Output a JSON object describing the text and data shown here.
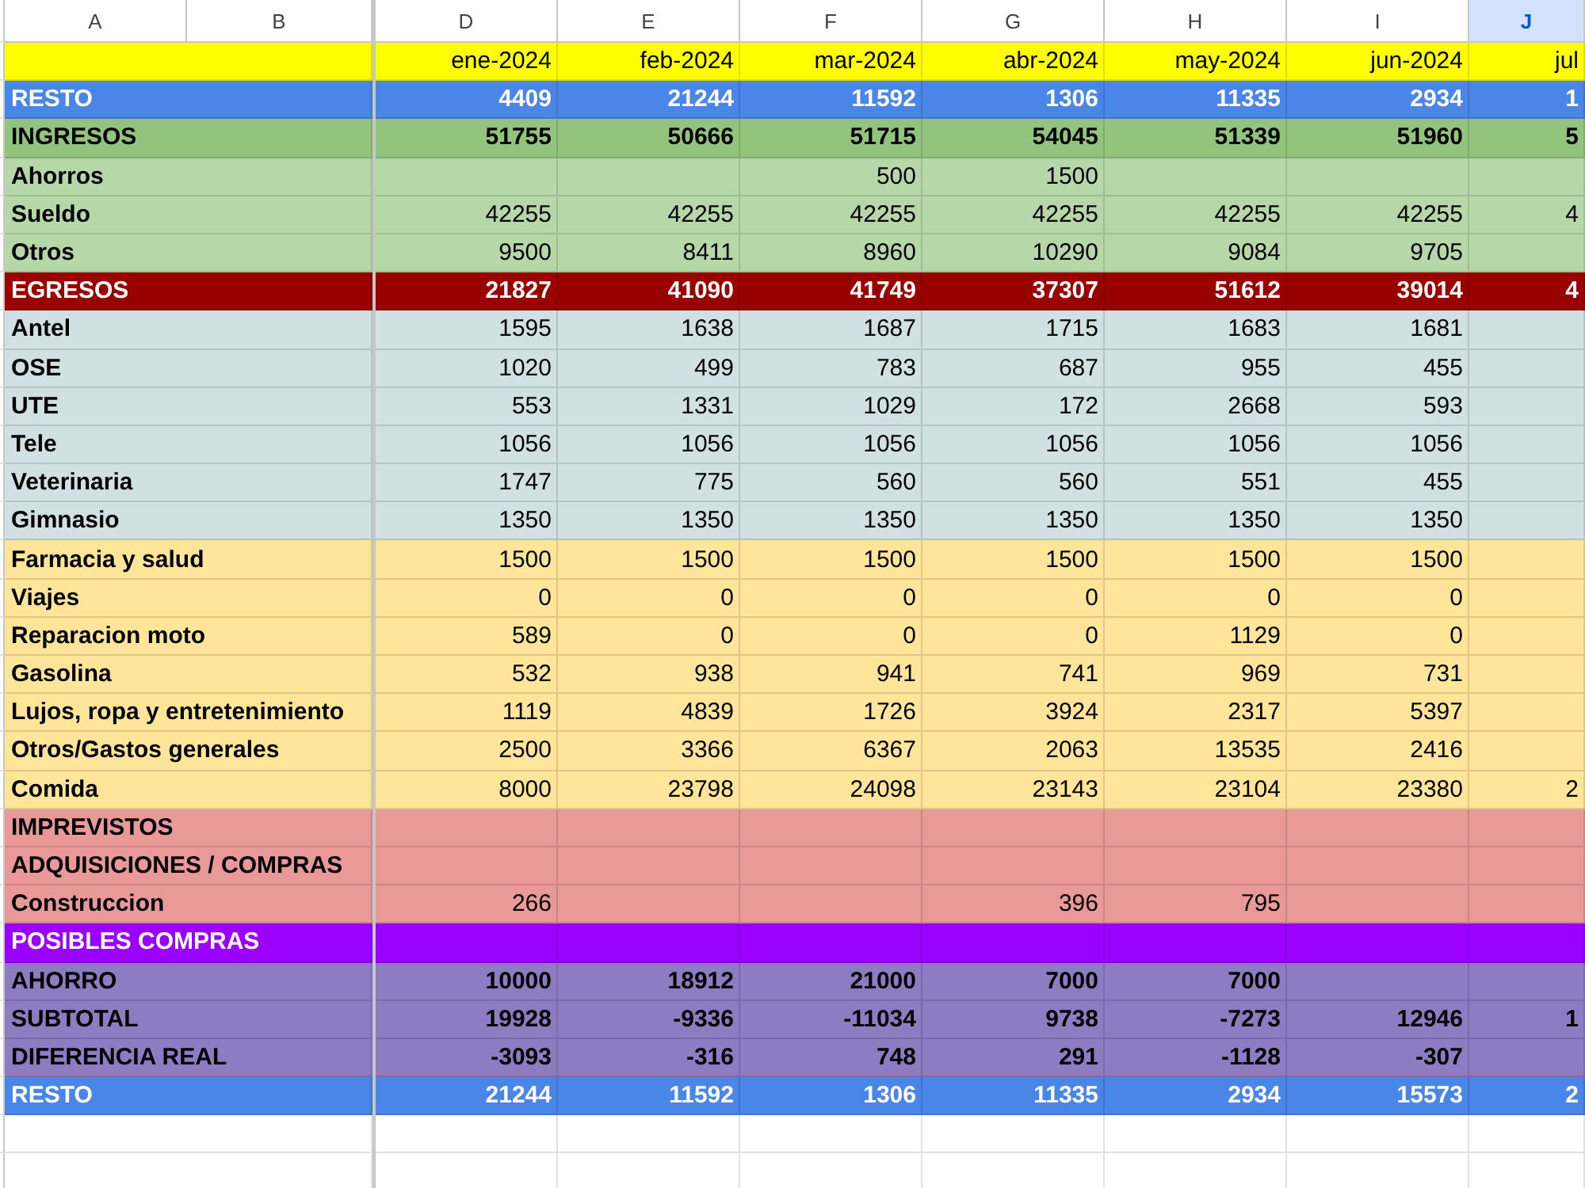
{
  "columns": [
    {
      "label": "A",
      "selected": false
    },
    {
      "label": "B",
      "selected": false
    },
    {
      "label": "D",
      "selected": false
    },
    {
      "label": "E",
      "selected": false
    },
    {
      "label": "F",
      "selected": false
    },
    {
      "label": "G",
      "selected": false
    },
    {
      "label": "H",
      "selected": false
    },
    {
      "label": "I",
      "selected": false
    },
    {
      "label": "J",
      "selected": true
    }
  ],
  "rows": [
    {
      "kind": "months",
      "cells": [
        "ene-2024",
        "feb-2024",
        "mar-2024",
        "abr-2024",
        "may-2024",
        "jun-2024",
        "jul"
      ]
    },
    {
      "kind": "balance",
      "label": "RESTO",
      "cells": [
        "4409",
        "21244",
        "11592",
        "1306",
        "11335",
        "2934",
        "1"
      ]
    },
    {
      "kind": "income-total",
      "label": "INGRESOS",
      "cells": [
        "51755",
        "50666",
        "51715",
        "54045",
        "51339",
        "51960",
        "5"
      ]
    },
    {
      "kind": "income",
      "label": "Ahorros",
      "cells": [
        null,
        null,
        "500",
        "1500",
        null,
        null,
        null
      ]
    },
    {
      "kind": "income",
      "label": "Sueldo",
      "cells": [
        "42255",
        "42255",
        "42255",
        "42255",
        "42255",
        "42255",
        "4"
      ]
    },
    {
      "kind": "income",
      "label": "Otros",
      "cells": [
        "9500",
        "8411",
        "8960",
        "10290",
        "9084",
        "9705",
        null
      ]
    },
    {
      "kind": "expense-total",
      "label": "EGRESOS",
      "cells": [
        "21827",
        "41090",
        "41749",
        "37307",
        "51612",
        "39014",
        "4"
      ]
    },
    {
      "kind": "bill",
      "label": "Antel",
      "cells": [
        "1595",
        "1638",
        "1687",
        "1715",
        "1683",
        "1681",
        null
      ]
    },
    {
      "kind": "bill",
      "label": "OSE",
      "cells": [
        "1020",
        "499",
        "783",
        "687",
        "955",
        "455",
        null
      ]
    },
    {
      "kind": "bill",
      "label": "UTE",
      "cells": [
        "553",
        "1331",
        "1029",
        "172",
        "2668",
        "593",
        null
      ]
    },
    {
      "kind": "bill",
      "label": "Tele",
      "cells": [
        "1056",
        "1056",
        "1056",
        "1056",
        "1056",
        "1056",
        null
      ]
    },
    {
      "kind": "bill",
      "label": "Veterinaria",
      "cells": [
        "1747",
        "775",
        "560",
        "560",
        "551",
        "455",
        null
      ]
    },
    {
      "kind": "bill",
      "label": "Gimnasio",
      "cells": [
        "1350",
        "1350",
        "1350",
        "1350",
        "1350",
        "1350",
        null
      ]
    },
    {
      "kind": "variable",
      "label": "Farmacia y salud",
      "cells": [
        "1500",
        "1500",
        "1500",
        "1500",
        "1500",
        "1500",
        null
      ]
    },
    {
      "kind": "variable",
      "label": "Viajes",
      "cells": [
        "0",
        "0",
        "0",
        "0",
        "0",
        "0",
        null
      ]
    },
    {
      "kind": "variable",
      "label": "Reparacion moto",
      "cells": [
        "589",
        "0",
        "0",
        "0",
        "1129",
        "0",
        null
      ]
    },
    {
      "kind": "variable",
      "label": "Gasolina",
      "cells": [
        "532",
        "938",
        "941",
        "741",
        "969",
        "731",
        null
      ]
    },
    {
      "kind": "variable",
      "label": "Lujos, ropa y entretenimiento",
      "cells": [
        "1119",
        "4839",
        "1726",
        "3924",
        "2317",
        "5397",
        null
      ]
    },
    {
      "kind": "variable",
      "label": "Otros/Gastos generales",
      "cells": [
        "2500",
        "3366",
        "6367",
        "2063",
        "13535",
        "2416",
        null
      ]
    },
    {
      "kind": "variable",
      "label": "Comida",
      "cells": [
        "8000",
        "23798",
        "24098",
        "23143",
        "23104",
        "23380",
        "2"
      ]
    },
    {
      "kind": "unexpected",
      "label": "IMPREVISTOS",
      "cells": [
        null,
        null,
        null,
        null,
        null,
        null,
        null
      ]
    },
    {
      "kind": "unexpected",
      "label": "ADQUISICIONES / COMPRAS",
      "cells": [
        null,
        null,
        null,
        null,
        null,
        null,
        null
      ]
    },
    {
      "kind": "unexpected",
      "label": "Construccion",
      "cells": [
        "266",
        null,
        null,
        "396",
        "795",
        null,
        null
      ]
    },
    {
      "kind": "purchases",
      "label": "POSIBLES COMPRAS",
      "cells": [
        null,
        null,
        null,
        null,
        null,
        null,
        null
      ]
    },
    {
      "kind": "summary",
      "label": "AHORRO",
      "cells": [
        "10000",
        "18912",
        "21000",
        "7000",
        "7000",
        null,
        null
      ]
    },
    {
      "kind": "summary",
      "label": "SUBTOTAL",
      "cells": [
        "19928",
        "-9336",
        "-11034",
        "9738",
        "-7273",
        "12946",
        "1"
      ]
    },
    {
      "kind": "summary",
      "label": "DIFERENCIA REAL",
      "cells": [
        "-3093",
        "-316",
        "748",
        "291",
        "-1128",
        "-307",
        null
      ]
    },
    {
      "kind": "balance",
      "label": "RESTO",
      "cells": [
        "21244",
        "11592",
        "1306",
        "11335",
        "2934",
        "15573",
        "2"
      ]
    }
  ]
}
